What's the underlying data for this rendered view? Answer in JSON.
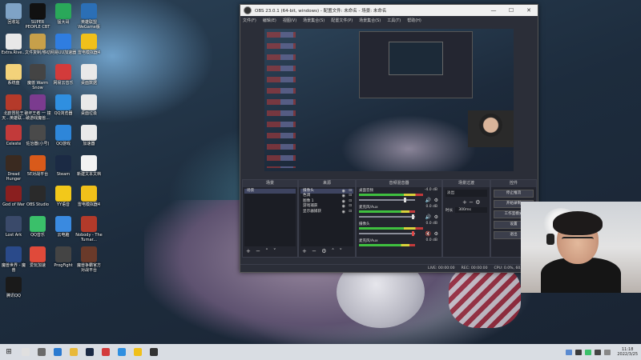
{
  "desktop": {
    "icons": [
      {
        "label": "回收站",
        "color": "#7fa3c6"
      },
      {
        "label": "SUPER PEOPLE CBT",
        "color": "#111111"
      },
      {
        "label": "猛大哥",
        "color": "#2aa85a"
      },
      {
        "label": "英雄联盟WeGame版",
        "color": "#2b6fb6"
      },
      {
        "label": "Extra.Rive...",
        "color": "#e8e8e8"
      },
      {
        "label": "文件复制/移动",
        "color": "#c7a04a"
      },
      {
        "label": "网易UU加速器",
        "color": "#2f7de0"
      },
      {
        "label": "雷电模拟器4",
        "color": "#f0c01a"
      },
      {
        "label": "系统盘",
        "color": "#f3d27a"
      },
      {
        "label": "魔兽 Warm Snow",
        "color": "#444444"
      },
      {
        "label": "网易云音乐",
        "color": "#d33b3b"
      },
      {
        "label": "桌面数据",
        "color": "#e9e9e9"
      },
      {
        "label": "北欧冒险王 天...英雄联...",
        "color": "#b53a2a"
      },
      {
        "label": "破坏王者 一 撞破游戏魔兽...",
        "color": "#7b3b8f"
      },
      {
        "label": "QQ浏览器",
        "color": "#2f8fe0"
      },
      {
        "label": "桌面垃圾",
        "color": "#e9e9e9"
      },
      {
        "label": "Celeste",
        "color": "#c23a3a"
      },
      {
        "label": "佐治器(小号)",
        "color": "#4a4a4a"
      },
      {
        "label": "QQ游戏",
        "color": "#2e86d9"
      },
      {
        "label": "加速器",
        "color": "#e9e9e9"
      },
      {
        "label": "Dread Hunger",
        "color": "#3a2a20"
      },
      {
        "label": "5E对战平台",
        "color": "#d95a1a"
      },
      {
        "label": "Steam",
        "color": "#1b2a44"
      },
      {
        "label": "新建文本文档",
        "color": "#f2f2f2"
      },
      {
        "label": "God of War",
        "color": "#8a1f1f"
      },
      {
        "label": "OBS Studio",
        "color": "#2a2a2a"
      },
      {
        "label": "YY语音",
        "color": "#f2c81a"
      },
      {
        "label": "雷电模拟器4",
        "color": "#f0c01a"
      },
      {
        "label": "Lost Ark",
        "color": "#3a4a6a"
      },
      {
        "label": "QQ音乐",
        "color": "#3ac06a"
      },
      {
        "label": "云电脑",
        "color": "#3a8ae0"
      },
      {
        "label": "Nobody - The Turnar...",
        "color": "#b23a2a"
      },
      {
        "label": "魔兽世界 - 魔兽",
        "color": "#2a4a8a"
      },
      {
        "label": "爱玩加速",
        "color": "#e04a3a"
      },
      {
        "label": "ProgFight",
        "color": "#444444"
      },
      {
        "label": "魔兽争霸官方对战平台",
        "color": "#6a3a2a"
      },
      {
        "label": "腾讯QQ",
        "color": "#1a1a1a"
      }
    ]
  },
  "obs": {
    "title": "OBS 23.0.1 (64-bit, windows) - 配置文件: 未命名 - 场景: 未命名",
    "menu": [
      "文件(F)",
      "编辑(E)",
      "视图(V)",
      "场景集合(S)",
      "配置文件(P)",
      "场景集合(S)",
      "工具(T)",
      "帮助(H)"
    ],
    "scenes": {
      "title": "场景",
      "items": [
        "场景"
      ]
    },
    "sources": {
      "title": "来源",
      "items": [
        "摄像头",
        "色调",
        "图像 1",
        "游戏捕获",
        "显示器捕获"
      ]
    },
    "mixer": {
      "title": "音频混音器",
      "tracks": [
        {
          "name": "桌面音频",
          "db": "-4.0 dB"
        },
        {
          "name": "麦克风/Aux",
          "db": "0.0 dB"
        },
        {
          "name": "摄像头",
          "db": "0.0 dB"
        },
        {
          "name": "麦克风/Aux",
          "db": "0.0 dB"
        }
      ]
    },
    "transitions": {
      "title": "场景过渡",
      "type": "淡出",
      "duration_label": "时长",
      "duration": "300ms"
    },
    "controls": {
      "title": "控件",
      "buttons": [
        "停止推流",
        "开始录制",
        "工作室模式",
        "设置",
        "退出"
      ]
    },
    "status": {
      "lost": "LIVE: 00:00:00",
      "rec": "REC: 00:00:00",
      "cpu": "CPU: 0.0%, 60.00 fps"
    }
  },
  "taskbar": {
    "apps": [
      {
        "name": "qq",
        "color": "#e0e0e0"
      },
      {
        "name": "task-view",
        "color": "#6a6a6a"
      },
      {
        "name": "edge",
        "color": "#2a7ad0"
      },
      {
        "name": "file-explorer",
        "color": "#e8b93a"
      },
      {
        "name": "steam",
        "color": "#1b2a44"
      },
      {
        "name": "netease-music",
        "color": "#d33b3b"
      },
      {
        "name": "browser",
        "color": "#2f8fe0"
      },
      {
        "name": "ld-player",
        "color": "#f0c01a"
      },
      {
        "name": "obs",
        "color": "#333333"
      }
    ],
    "time": "11:18",
    "date": "2022/3/25"
  }
}
